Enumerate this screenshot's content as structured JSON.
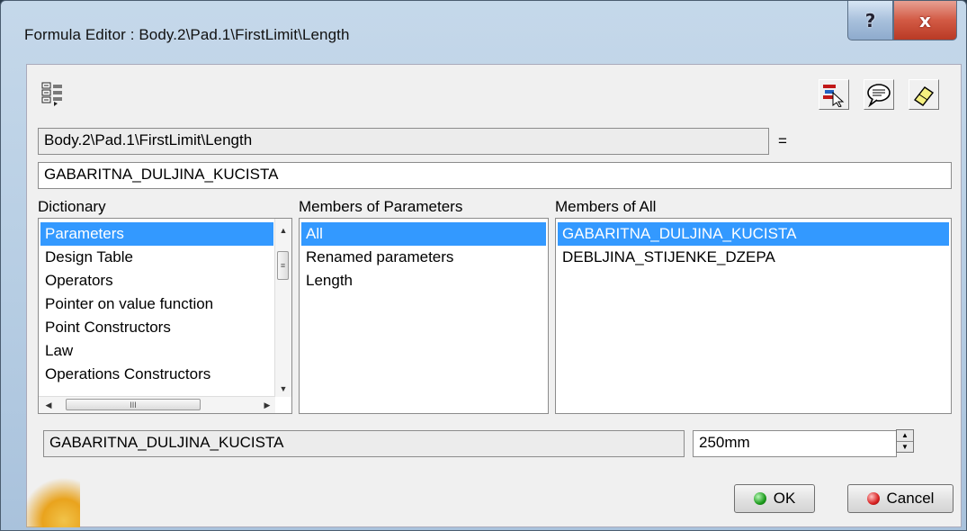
{
  "window": {
    "title": "Formula Editor : Body.2\\Pad.1\\FirstLimit\\Length",
    "help_label": "?",
    "close_label": "x"
  },
  "toolbar": {
    "left_icon": "formula-tree-icon",
    "right_icons": [
      "select-member-icon",
      "comment-icon",
      "eraser-icon"
    ]
  },
  "parameter_path": "Body.2\\Pad.1\\FirstLimit\\Length",
  "equals_sign": "=",
  "formula": {
    "value": "GABARITNA_DULJINA_KUCISTA"
  },
  "dictionary": {
    "header": "Dictionary",
    "items": [
      "Parameters",
      "Design Table",
      "Operators",
      "Pointer on value function",
      "Point Constructors",
      "Law",
      "Operations Constructors"
    ],
    "selected_index": 0,
    "hscroll_grip": "III"
  },
  "members_params": {
    "header": "Members of Parameters",
    "items": [
      "All",
      "Renamed parameters",
      "Length"
    ],
    "selected_index": 0
  },
  "members_all": {
    "header": "Members of All",
    "items": [
      "GABARITNA_DULJINA_KUCISTA",
      "DEBLJINA_STIJENKE_DZEPA"
    ],
    "selected_index": 0
  },
  "bottom": {
    "selected_name": "GABARITNA_DULJINA_KUCISTA",
    "value": "250mm"
  },
  "buttons": {
    "ok": "OK",
    "cancel": "Cancel"
  },
  "colors": {
    "selection": "#3399ff",
    "title_bar": "#b6cde3",
    "close_button": "#c8432c"
  }
}
